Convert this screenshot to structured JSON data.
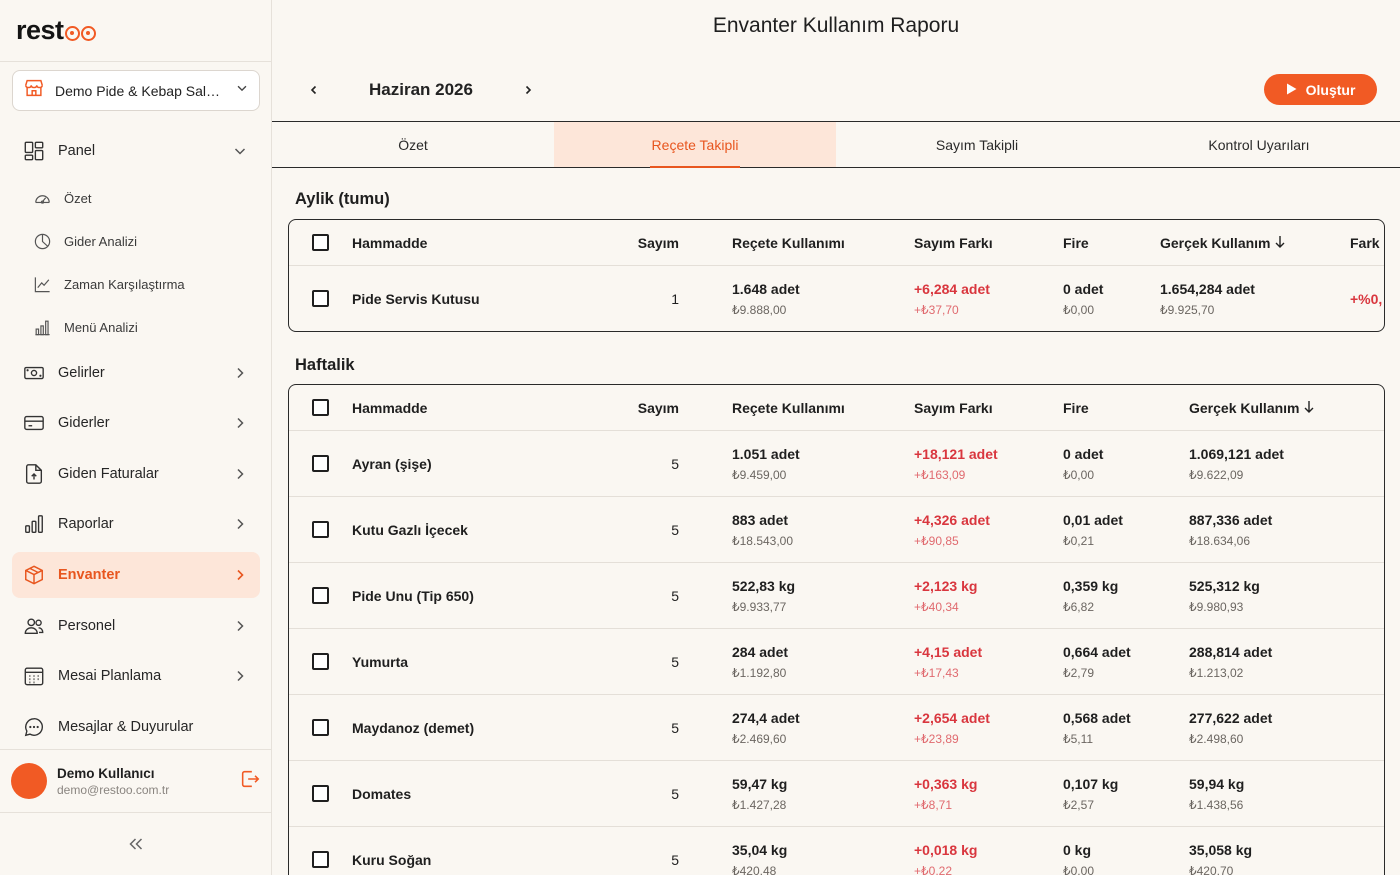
{
  "brand": {
    "logo_text": "rest",
    "accent": "#f15a24"
  },
  "branch_selector": {
    "value": "Demo Pide & Kebap Salon..."
  },
  "sidebar": {
    "panel": {
      "label": "Panel"
    },
    "sub_items": [
      {
        "label": "Özet",
        "icon": "gauge-icon"
      },
      {
        "label": "Gider Analizi",
        "icon": "pie-chart-icon"
      },
      {
        "label": "Zaman Karşılaştırma",
        "icon": "line-chart-icon"
      },
      {
        "label": "Menü Analizi",
        "icon": "bar-chart-icon"
      }
    ],
    "items": [
      {
        "label": "Gelirler",
        "icon": "banknote-icon"
      },
      {
        "label": "Giderler",
        "icon": "credit-card-icon"
      },
      {
        "label": "Giden Faturalar",
        "icon": "file-upload-icon"
      },
      {
        "label": "Raporlar",
        "icon": "bar-chart-icon"
      },
      {
        "label": "Envanter",
        "icon": "box-icon",
        "active": true
      },
      {
        "label": "Personel",
        "icon": "users-icon"
      },
      {
        "label": "Mesai Planlama",
        "icon": "calendar-icon"
      },
      {
        "label": "Mesajlar & Duyurular",
        "icon": "chat-icon"
      }
    ]
  },
  "user": {
    "name": "Demo Kullanıcı",
    "email": "demo@restoo.com.tr"
  },
  "header": {
    "title": "Envanter Kullanım Raporu",
    "month": "Haziran 2026",
    "create_label": "Oluştur"
  },
  "tabs": [
    {
      "label": "Özet"
    },
    {
      "label": "Reçete Takipli",
      "active": true
    },
    {
      "label": "Sayım Takipli"
    },
    {
      "label": "Kontrol Uyarıları"
    }
  ],
  "columns": {
    "name": "Hammadde",
    "count": "Sayım",
    "recipe": "Reçete Kullanımı",
    "diff": "Sayım Farkı",
    "fire": "Fire",
    "real": "Gerçek Kullanım",
    "fark": "Fark"
  },
  "monthly": {
    "title": "Aylik (tumu)",
    "rows": [
      {
        "name": "Pide Servis Kutusu",
        "count": "1",
        "recipe": "1.648 adet",
        "recipe_cost": "₺9.888,00",
        "diff": "+6,284 adet",
        "diff_cost": "+₺37,70",
        "fire": "0 adet",
        "fire_cost": "₺0,00",
        "real": "1.654,284 adet",
        "real_cost": "₺9.925,70",
        "fark": "+%0,"
      }
    ]
  },
  "weekly": {
    "title": "Haftalik",
    "rows": [
      {
        "name": "Ayran (şişe)",
        "count": "5",
        "recipe": "1.051 adet",
        "recipe_cost": "₺9.459,00",
        "diff": "+18,121 adet",
        "diff_cost": "+₺163,09",
        "fire": "0 adet",
        "fire_cost": "₺0,00",
        "real": "1.069,121 adet",
        "real_cost": "₺9.622,09"
      },
      {
        "name": "Kutu Gazlı İçecek",
        "count": "5",
        "recipe": "883 adet",
        "recipe_cost": "₺18.543,00",
        "diff": "+4,326 adet",
        "diff_cost": "+₺90,85",
        "fire": "0,01 adet",
        "fire_cost": "₺0,21",
        "real": "887,336 adet",
        "real_cost": "₺18.634,06"
      },
      {
        "name": "Pide Unu (Tip 650)",
        "count": "5",
        "recipe": "522,83 kg",
        "recipe_cost": "₺9.933,77",
        "diff": "+2,123 kg",
        "diff_cost": "+₺40,34",
        "fire": "0,359 kg",
        "fire_cost": "₺6,82",
        "real": "525,312 kg",
        "real_cost": "₺9.980,93"
      },
      {
        "name": "Yumurta",
        "count": "5",
        "recipe": "284 adet",
        "recipe_cost": "₺1.192,80",
        "diff": "+4,15 adet",
        "diff_cost": "+₺17,43",
        "fire": "0,664 adet",
        "fire_cost": "₺2,79",
        "real": "288,814 adet",
        "real_cost": "₺1.213,02"
      },
      {
        "name": "Maydanoz (demet)",
        "count": "5",
        "recipe": "274,4 adet",
        "recipe_cost": "₺2.469,60",
        "diff": "+2,654 adet",
        "diff_cost": "+₺23,89",
        "fire": "0,568 adet",
        "fire_cost": "₺5,11",
        "real": "277,622 adet",
        "real_cost": "₺2.498,60"
      },
      {
        "name": "Domates",
        "count": "5",
        "recipe": "59,47 kg",
        "recipe_cost": "₺1.427,28",
        "diff": "+0,363 kg",
        "diff_cost": "+₺8,71",
        "fire": "0,107 kg",
        "fire_cost": "₺2,57",
        "real": "59,94 kg",
        "real_cost": "₺1.438,56"
      },
      {
        "name": "Kuru Soğan",
        "count": "5",
        "recipe": "35,04 kg",
        "recipe_cost": "₺420,48",
        "diff": "+0,018 kg",
        "diff_cost": "+₺0,22",
        "fire": "0 kg",
        "fire_cost": "₺0,00",
        "real": "35,058 kg",
        "real_cost": "₺420,70"
      }
    ]
  }
}
